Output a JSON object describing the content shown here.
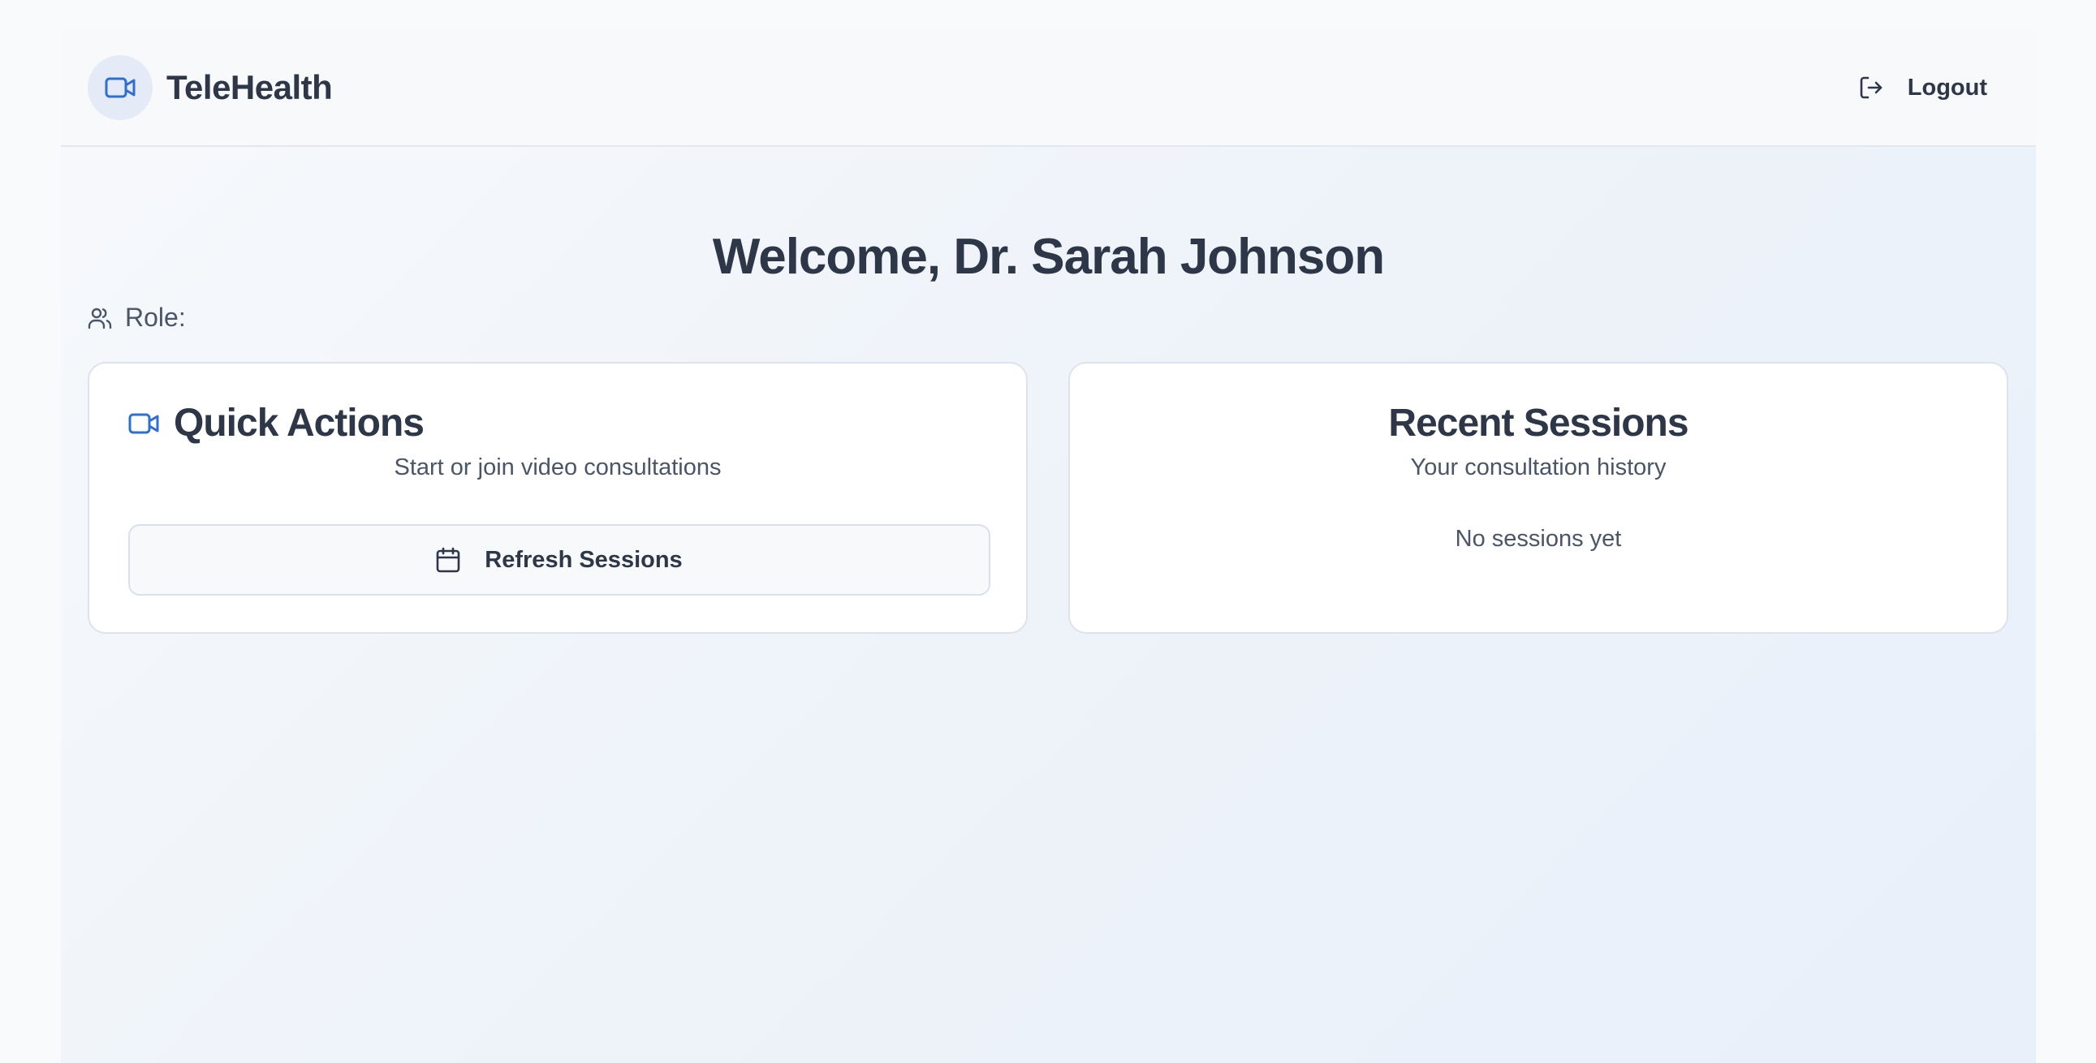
{
  "brand": {
    "name": "TeleHealth",
    "icon": "video-camera-icon",
    "accent_color": "#2f6fd0"
  },
  "header": {
    "logout_label": "Logout",
    "logout_icon": "logout-icon"
  },
  "welcome": {
    "title": "Welcome, Dr. Sarah Johnson",
    "role_label": "Role:",
    "role_icon": "users-icon"
  },
  "quick_actions": {
    "title": "Quick Actions",
    "subtitle": "Start or join video consultations",
    "icon": "video-camera-icon",
    "refresh_label": "Refresh Sessions",
    "refresh_icon": "calendar-icon"
  },
  "recent_sessions": {
    "title": "Recent Sessions",
    "subtitle": "Your consultation history",
    "empty_text": "No sessions yet"
  }
}
